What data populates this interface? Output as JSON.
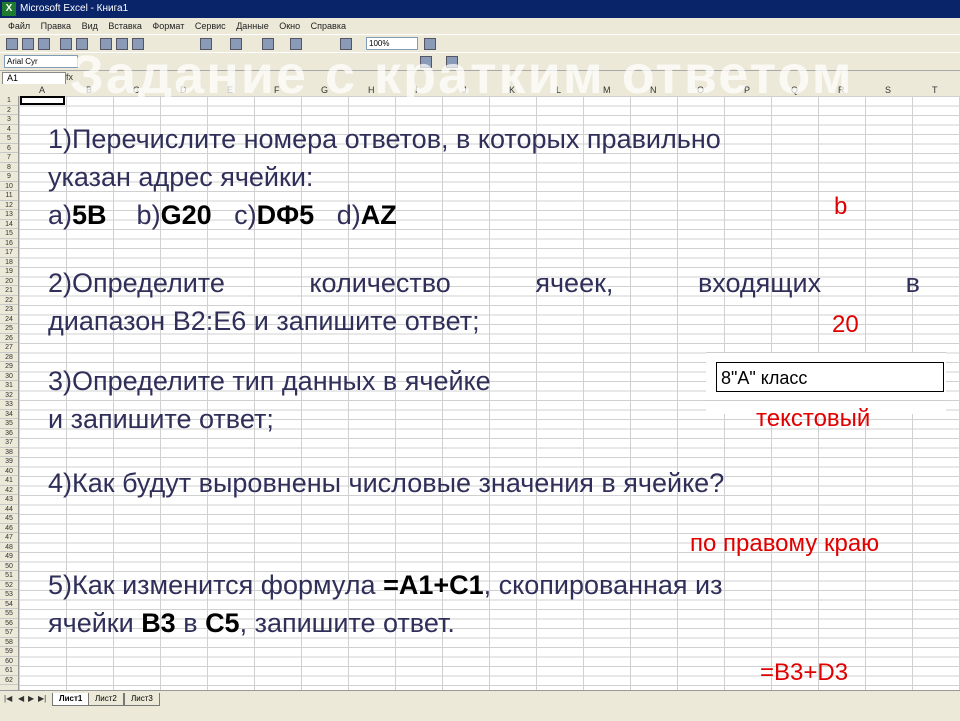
{
  "window": {
    "title": "Microsoft Excel - Книга1"
  },
  "menu": [
    "Файл",
    "Правка",
    "Вид",
    "Вставка",
    "Формат",
    "Сервис",
    "Данные",
    "Окно",
    "Справка"
  ],
  "toolbar": {
    "zoom": "100%",
    "font": "Arial Cyr"
  },
  "formula_bar": {
    "name_box": "A1",
    "fx": "fx"
  },
  "ghost_title": "Задание с кратким ответом",
  "columns": [
    "A",
    "B",
    "C",
    "D",
    "E",
    "F",
    "G",
    "H",
    "I",
    "J",
    "K",
    "L",
    "M",
    "N",
    "O",
    "P",
    "Q",
    "R",
    "S",
    "T"
  ],
  "sheet_tabs": [
    "Лист1",
    "Лист2",
    "Лист3"
  ],
  "questions": {
    "q1": {
      "text_line1": "1)Перечислите номера ответов, в которых правильно",
      "text_line2": "указан адрес ячейки:",
      "opt_a_prefix": "a)",
      "opt_a": "5B",
      "opt_b_prefix": "b)",
      "opt_b": "G20",
      "opt_c_prefix": "c)",
      "opt_c": "DФ5",
      "opt_d_prefix": "d)",
      "opt_d": "AZ",
      "answer": "b"
    },
    "q2": {
      "line1": "2)Определите количество ячеек, входящих в",
      "line2": "диапазон B2:E6 и запишите ответ;",
      "answer": "20"
    },
    "q3": {
      "line1": "3)Определите тип данных в ячейке",
      "line2": "и запишите ответ;",
      "cell_content": "8\"А\" класс",
      "answer": "текстовый"
    },
    "q4": {
      "text": "4)Как будут выровнены числовые значения в ячейке?",
      "answer": "по правому краю"
    },
    "q5": {
      "part1": "5)Как изменится формула ",
      "formula": "=A1+C1",
      "part2": ", скопированная из",
      "part3": "ячейки ",
      "from": "B3",
      "part4": " в ",
      "to": "C5",
      "part5": ", запишите ответ.",
      "answer": "=B3+D3"
    }
  },
  "colors": {
    "answer": "#e10000",
    "question_text": "#2f2f5a"
  }
}
